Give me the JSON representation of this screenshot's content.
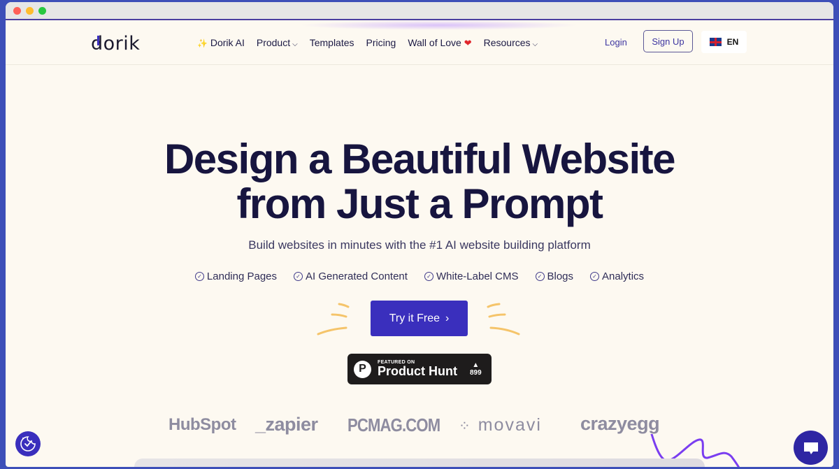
{
  "window": {
    "controls": [
      "close",
      "minimize",
      "maximize"
    ],
    "control_colors": [
      "#ff5f57",
      "#febc2e",
      "#28c840"
    ]
  },
  "nav": {
    "logo": "dorik",
    "items": [
      {
        "label": "Dorik AI",
        "icon": "sparkles-icon"
      },
      {
        "label": "Product",
        "dropdown": true
      },
      {
        "label": "Templates"
      },
      {
        "label": "Pricing"
      },
      {
        "label": "Wall of Love",
        "icon": "heart-icon"
      },
      {
        "label": "Resources",
        "dropdown": true
      }
    ],
    "sparkle_glyph": "✨",
    "heart_glyph": "❤️",
    "chevron_glyph": "⌄",
    "login": "Login",
    "signup": "Sign Up",
    "language": "EN"
  },
  "hero": {
    "title_line1": "Design a Beautiful Website",
    "title_line2": "from Just a Prompt",
    "subtitle": "Build websites in minutes with the #1 AI website building platform",
    "features": [
      "Landing Pages",
      "AI Generated Content",
      "White-Label CMS",
      "Blogs",
      "Analytics"
    ],
    "cta": "Try it Free",
    "cta_arrow": "›"
  },
  "product_hunt": {
    "badge_small": "FEATURED ON",
    "badge_big": "Product Hunt",
    "logo_letter": "P",
    "upvote_glyph": "▲",
    "votes": "899"
  },
  "logos": [
    "HubSpot",
    "_zapier",
    "PCMAG.COM",
    "movavi",
    "crazyegg"
  ],
  "colors": {
    "accent": "#3a2fbd",
    "title": "#17153f",
    "background": "#fdf9f1",
    "frame": "#3d4fb8",
    "logo_gray": "#8e8ca0"
  }
}
